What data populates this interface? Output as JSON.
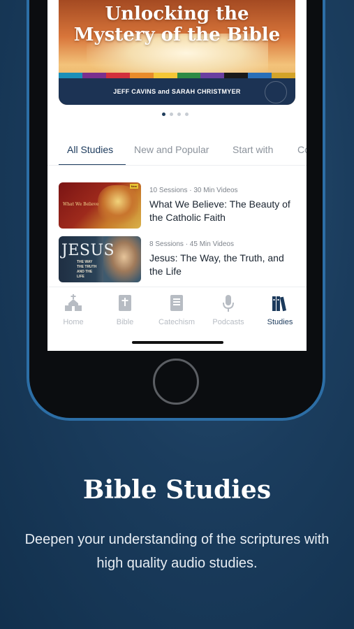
{
  "hero": {
    "title_line1": "Unlocking the",
    "title_line2": "Mystery of the Bible",
    "authors": "JEFF CAVINS and SARAH CHRISTMYER",
    "stripe_colors": [
      "#1c8fb8",
      "#7a2f8e",
      "#d22f3c",
      "#e98b2a",
      "#f4c636",
      "#2e8a45",
      "#6a3fa0",
      "#1a1a1a",
      "#2a6fb8",
      "#d4a328"
    ]
  },
  "carousel": {
    "total": 4,
    "active_index": 0
  },
  "tabs": [
    {
      "label": "All Studies",
      "active": true
    },
    {
      "label": "New and Popular",
      "active": false
    },
    {
      "label": "Start with",
      "active": false
    },
    {
      "label": "Co",
      "active": false
    }
  ],
  "studies": [
    {
      "meta": "10 Sessions · 30 Min Videos",
      "title": "What We Believe: The Beauty of the Catholic Faith",
      "thumb_text": "What We Believe",
      "thumb_badge": "New"
    },
    {
      "meta": "8 Sessions · 45 Min Videos",
      "title": "Jesus: The Way, the Truth, and the Life",
      "thumb_title": "JESUS",
      "thumb_subtitle": "THE WAY THE TRUTH AND THE LIFE"
    }
  ],
  "nav": [
    {
      "label": "Home",
      "icon": "church-icon",
      "active": false
    },
    {
      "label": "Bible",
      "icon": "bible-icon",
      "active": false
    },
    {
      "label": "Catechism",
      "icon": "catechism-icon",
      "active": false
    },
    {
      "label": "Podcasts",
      "icon": "microphone-icon",
      "active": false
    },
    {
      "label": "Studies",
      "icon": "studies-books-icon",
      "active": true
    }
  ],
  "marketing": {
    "headline": "Bible Studies",
    "subcopy": "Deepen your understanding of the scriptures with high quality audio studies."
  },
  "colors": {
    "accent": "#1c3a5c",
    "inactive": "#b7bcc3",
    "phone_border": "#2c6ea6"
  }
}
